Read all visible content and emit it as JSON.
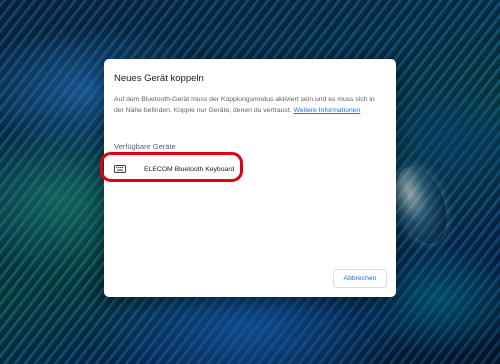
{
  "dialog": {
    "title": "Neues Gerät koppeln",
    "description": "Auf dem Bluetooth-Gerät muss der Kopplungsmodus aktiviert sein und es muss sich in der Nähe befinden. Kopple nur Geräte, denen du vertraust.",
    "more_info_link": "Weitere Informationen",
    "section_heading": "Verfügbare Geräte",
    "devices": [
      {
        "name": "ELECOM Bluetooth Keyboard",
        "icon": "keyboard-icon"
      }
    ],
    "cancel_label": "Abbrechen"
  },
  "colors": {
    "accent": "#1a73e8",
    "highlight": "#e0000f",
    "dialog_bg": "#ffffff",
    "text_primary": "#202124",
    "text_secondary": "#5f6368"
  }
}
